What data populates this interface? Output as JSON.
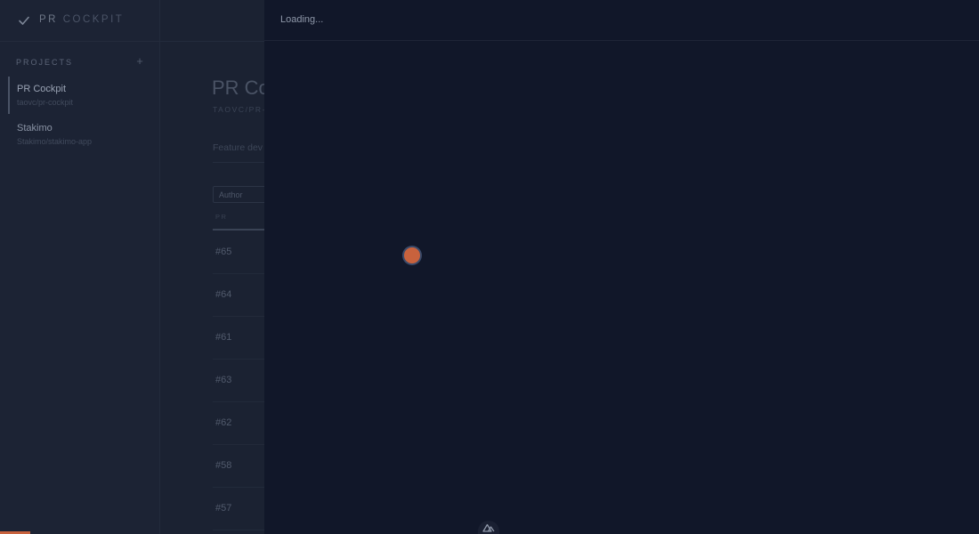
{
  "brand": {
    "prefix": "PR",
    "suffix": "COCKPIT",
    "icon": "check-icon"
  },
  "sidebar": {
    "projects_label": "PROJECTS",
    "add_label": "+",
    "projects": [
      {
        "name": "PR Cockpit",
        "repo": "taovc/pr-cockpit",
        "active": true
      },
      {
        "name": "Stakimo",
        "repo": "Stakimo/stakimo-app",
        "active": false
      }
    ]
  },
  "main": {
    "title": "PR Coc",
    "subtitle": "TAOVC/PR-",
    "description": "Feature dev",
    "author_filter": "Author",
    "column_pr": "PR",
    "rows": [
      "#65",
      "#64",
      "#61",
      "#63",
      "#62",
      "#58",
      "#57"
    ]
  },
  "overlay": {
    "loading_text": "Loading...",
    "accent_color": "#c8623d"
  },
  "progress": {
    "fraction": 0.031
  }
}
